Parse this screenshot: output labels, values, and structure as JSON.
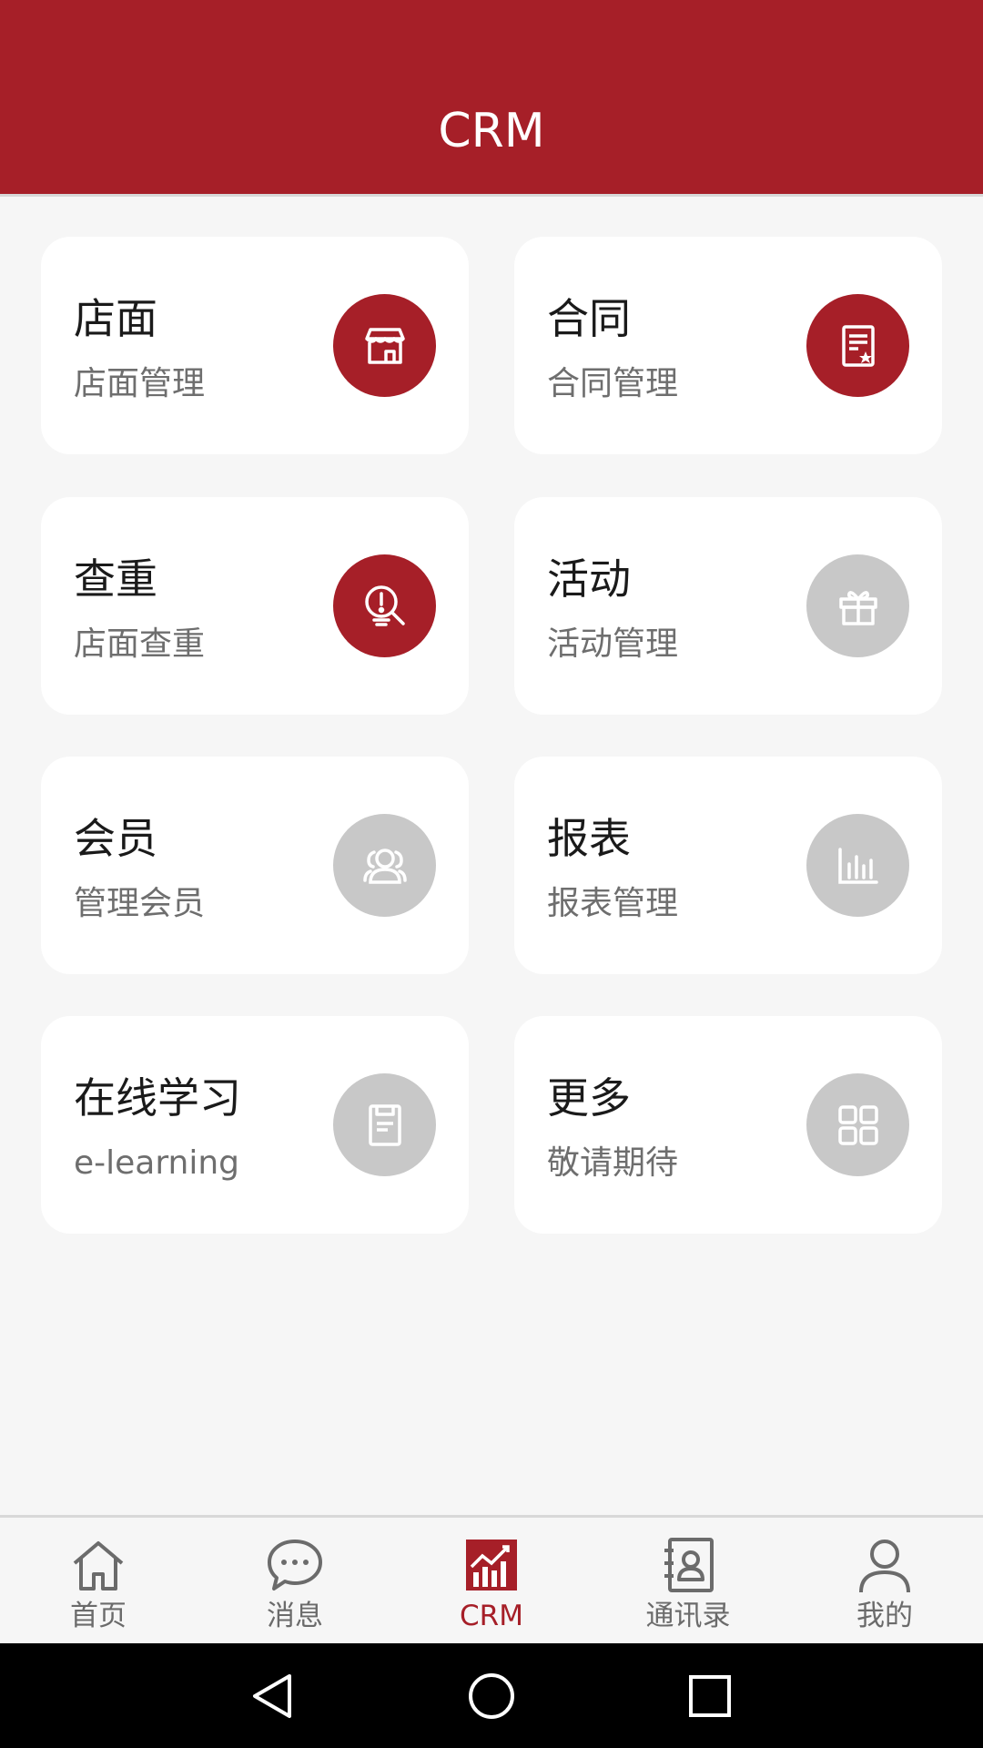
{
  "header": {
    "title": "CRM"
  },
  "colors": {
    "brand": "#a61f28",
    "inactive_icon_bg": "#c8c8c8",
    "tab_inactive": "#6b6b6b"
  },
  "cards": [
    {
      "title": "店面",
      "subtitle": "店面管理",
      "icon": "storefront-icon",
      "icon_style": "red"
    },
    {
      "title": "合同",
      "subtitle": "合同管理",
      "icon": "contract-icon",
      "icon_style": "red"
    },
    {
      "title": "查重",
      "subtitle": "店面查重",
      "icon": "alert-search-icon",
      "icon_style": "red"
    },
    {
      "title": "活动",
      "subtitle": "活动管理",
      "icon": "gift-icon",
      "icon_style": "gray"
    },
    {
      "title": "会员",
      "subtitle": "管理会员",
      "icon": "members-icon",
      "icon_style": "gray"
    },
    {
      "title": "报表",
      "subtitle": "报表管理",
      "icon": "bar-chart-icon",
      "icon_style": "gray"
    },
    {
      "title": "在线学习",
      "subtitle": "e-learning",
      "icon": "document-icon",
      "icon_style": "gray"
    },
    {
      "title": "更多",
      "subtitle": "敬请期待",
      "icon": "grid-icon",
      "icon_style": "gray"
    }
  ],
  "tabbar": {
    "items": [
      {
        "label": "首页",
        "icon": "home-icon"
      },
      {
        "label": "消息",
        "icon": "chat-icon"
      },
      {
        "label": "CRM",
        "icon": "chart-icon",
        "active": true
      },
      {
        "label": "通讯录",
        "icon": "contacts-icon"
      },
      {
        "label": "我的",
        "icon": "person-icon"
      }
    ]
  },
  "system_nav": {
    "items": [
      "back-icon",
      "home-circle-icon",
      "recents-icon"
    ]
  }
}
